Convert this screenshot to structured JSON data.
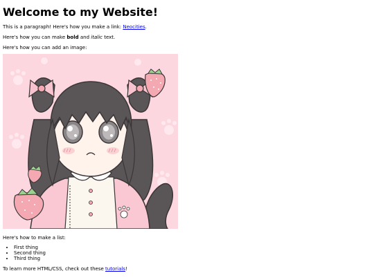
{
  "page": {
    "heading": "Welcome to my Website!",
    "link_intro": "This is a paragraph! Here's how you make a link: ",
    "link_text": "Neocities",
    "link_end": ".",
    "bold_intro": "Here's how you can make ",
    "bold_text": "bold",
    "bold_mid": " and ",
    "italic_text": "italic",
    "italic_end": " text.",
    "image_intro": "Here's how you can add an image:",
    "list_intro": "Here's how to make a list:",
    "list_items": [
      "First thing",
      "Second thing",
      "Third thing"
    ],
    "learn_intro": "To learn more HTML/CSS, check out these ",
    "learn_link": "tutorials",
    "learn_end": "!"
  },
  "colors": {
    "link": "#0000ee",
    "image_background": "#fdd7e0",
    "hair": "#5a5556",
    "bow": "#f7c3cf",
    "strawberry": "#f4a8b2",
    "shirt": "#fbf6ee"
  },
  "image": {
    "subject": "chibi girl with dark hair, pink bows, strawberries and a dog tail"
  }
}
